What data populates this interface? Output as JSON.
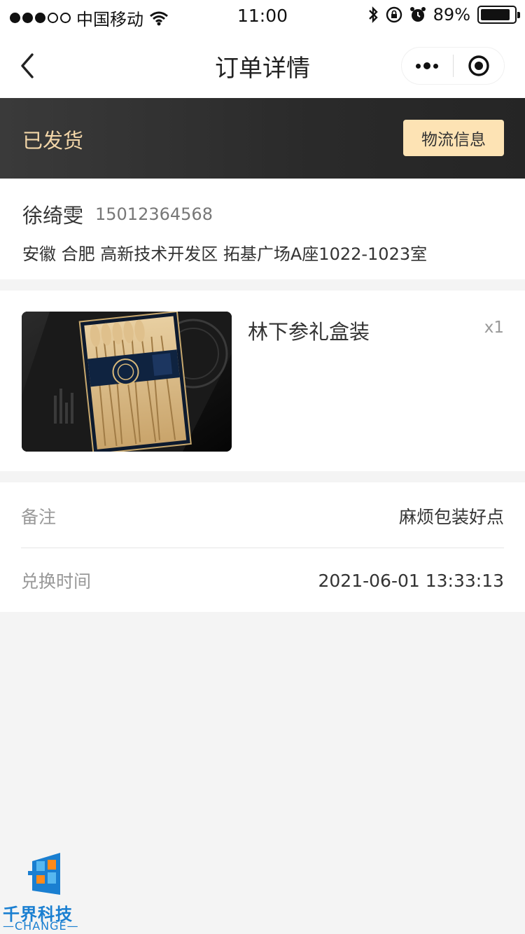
{
  "status_bar": {
    "carrier": "中国移动",
    "time": "11:00",
    "battery_percent": "89%",
    "battery_level": 0.89,
    "signal_bars": 3
  },
  "nav": {
    "title": "订单详情"
  },
  "order_status": {
    "label": "已发货",
    "logistics_button": "物流信息"
  },
  "address": {
    "name": "徐绮雯",
    "phone": "15012364568",
    "full_address": "安徽 合肥 高新技术开发区 拓基广场A座1022-1023室"
  },
  "product": {
    "name": "林下参礼盒装",
    "quantity": "x1"
  },
  "info": {
    "remark_label": "备注",
    "remark_value": "麻烦包装好点",
    "time_label": "兑换时间",
    "time_value": "2021-06-01 13:33:13"
  },
  "watermark": {
    "brand": "千界科技",
    "sub": "—CHANGE—"
  },
  "colors": {
    "banner_text": "#f3d6a8",
    "logistics_button_bg": "#fde3b4",
    "watermark_blue": "#1a7fd1"
  }
}
